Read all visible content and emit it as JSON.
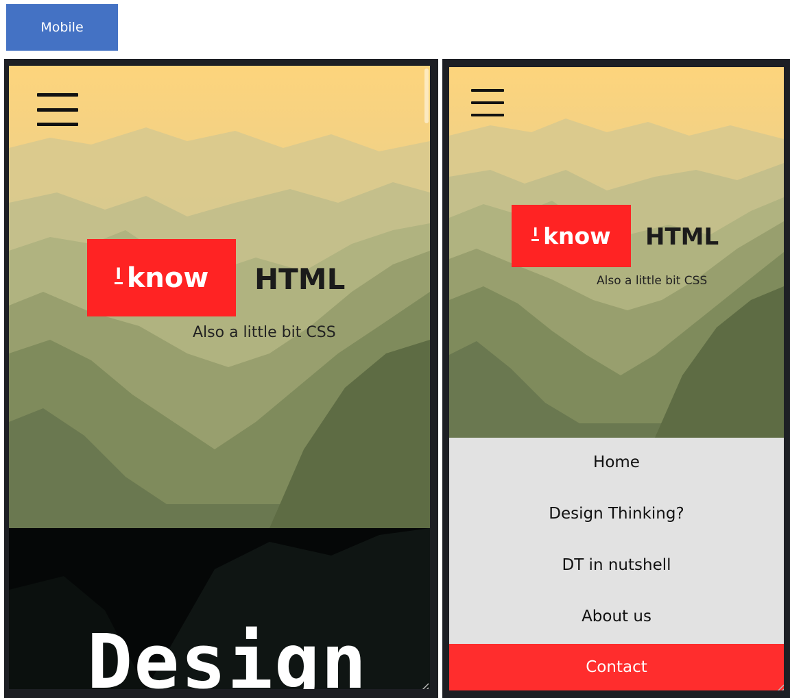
{
  "badge": {
    "label": "Mobile"
  },
  "colors": {
    "badge": "#4472c4",
    "logo": "#ff2323",
    "contact": "#ff2d2d",
    "nav_bg": "#e2e2e2",
    "frame": "#1d1f24"
  },
  "brand": {
    "logo_mark": "I",
    "logo_word": "know",
    "title": "HTML",
    "subtitle": "Also a little bit CSS"
  },
  "left_phone": {
    "section_heading": "Design"
  },
  "right_phone": {
    "nav_items": [
      "Home",
      "Design Thinking?",
      "DT in nutshell",
      "About us"
    ],
    "contact_label": "Contact"
  },
  "icons": [
    "hamburger-menu-icon",
    "resize-handle-icon"
  ]
}
